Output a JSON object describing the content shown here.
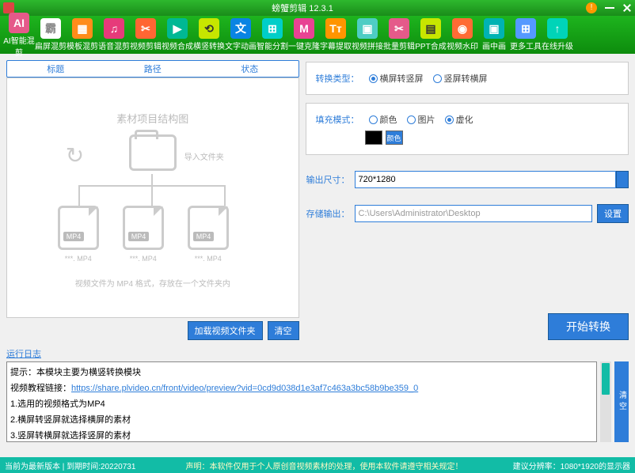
{
  "title": "螃蟹剪辑 12.3.1",
  "toolbar": [
    {
      "l": "AI智能混剪",
      "i": "AI"
    },
    {
      "l": "扁屏混剪",
      "i": "霸"
    },
    {
      "l": "模板混剪",
      "i": "▦"
    },
    {
      "l": "语音混剪",
      "i": "♫"
    },
    {
      "l": "视频剪辑",
      "i": "✂"
    },
    {
      "l": "视频合成",
      "i": "▶"
    },
    {
      "l": "横竖转换",
      "i": "⟲"
    },
    {
      "l": "文字动画",
      "i": "文"
    },
    {
      "l": "智能分割",
      "i": "⊞"
    },
    {
      "l": "一键克隆",
      "i": "M"
    },
    {
      "l": "字幕提取",
      "i": "Tт"
    },
    {
      "l": "视频拼接",
      "i": "▣"
    },
    {
      "l": "批量剪辑",
      "i": "✂"
    },
    {
      "l": "PPT合成",
      "i": "▤"
    },
    {
      "l": "视频水印",
      "i": "◉"
    },
    {
      "l": "画中画",
      "i": "▣"
    },
    {
      "l": "更多工具",
      "i": "⊞"
    },
    {
      "l": "在线升级",
      "i": "↑"
    }
  ],
  "cols": {
    "c1": "标题",
    "c2": "路径",
    "c3": "状态"
  },
  "diag": {
    "title": "素材项目结构图",
    "folder": "导入文件夹",
    "mp4": "MP4",
    "f1": "***. MP4",
    "f2": "***. MP4",
    "f3": "***. MP4",
    "hint": "视频文件为 MP4 格式，存放在一个文件夹内"
  },
  "btns": {
    "load": "加载视频文件夹",
    "clear": "清空",
    "start": "开始转换",
    "set": "设置",
    "logclear": "清空"
  },
  "opts": {
    "type_lbl": "转换类型：",
    "type1": "横屏转竖屏",
    "type2": "竖屏转横屏",
    "fill_lbl": "填充模式：",
    "fill1": "颜色",
    "fill2": "图片",
    "fill3": "虚化",
    "swatch": "颜色"
  },
  "form": {
    "size_lbl": "输出尺寸：",
    "size_val": "720*1280",
    "out_lbl": "存储输出：",
    "out_val": "C:\\Users\\Administrator\\Desktop"
  },
  "log": {
    "label": "运行日志",
    "l1": "提示：本模块主要为横竖转换模块",
    "l2a": "视频教程链接：",
    "l2b": "https://share.plvideo.cn/front/video/preview?vid=0cd9d038d1e3af7c463a3bc58b9be359_0",
    "l3": "1.选用的视频格式为MP4",
    "l4": "2.横屏转竖屏就选择横屏的素材",
    "l5": "3.竖屏转横屏就选择竖屏的素材"
  },
  "status": {
    "left": "当前为最新版本 | 到期时间:20220731",
    "mid": "声明：本软件仅用于个人原创音视频素材的处理，使用本软件请遵守相关规定！",
    "right": "建议分辨率：1080*1920的显示器"
  }
}
